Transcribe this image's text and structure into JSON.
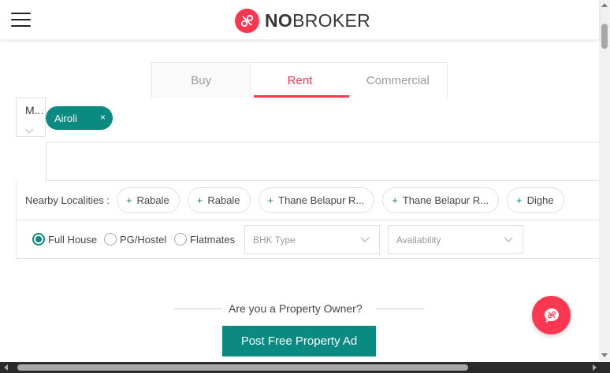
{
  "header": {
    "logo_bold": "NO",
    "logo_rest": "BROKER",
    "menu_icon": "hamburger-menu-icon",
    "logo_icon": "nobroker-logo-icon"
  },
  "tabs": [
    {
      "label": "Buy",
      "active": false
    },
    {
      "label": "Rent",
      "active": true
    },
    {
      "label": "Commercial",
      "active": false
    }
  ],
  "search": {
    "city": "M...",
    "selected_locality": "Airoli",
    "chip_close": "×",
    "query": ""
  },
  "nearby": {
    "label": "Nearby Localities :",
    "items": [
      "Rabale",
      "Rabale",
      "Thane Belapur R...",
      "Thane Belapur R...",
      "Dighe"
    ],
    "plus": "+"
  },
  "filters": {
    "types": [
      {
        "label": "Full House",
        "checked": true
      },
      {
        "label": "PG/Hostel",
        "checked": false
      },
      {
        "label": "Flatmates",
        "checked": false
      }
    ],
    "bhk_placeholder": "BHK Type",
    "availability_placeholder": "Availability"
  },
  "owner": {
    "question": "Are you a Property Owner?",
    "cta": "Post Free Property Ad"
  },
  "colors": {
    "brand_red": "#fd3752",
    "teal": "#0a8a80"
  }
}
